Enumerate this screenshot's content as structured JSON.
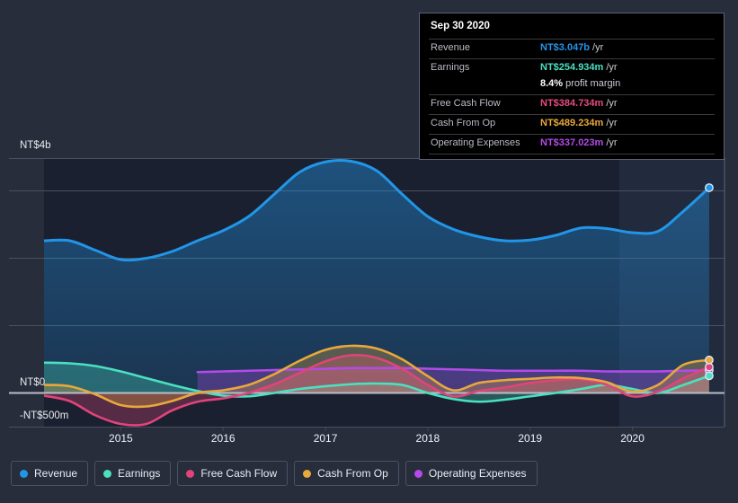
{
  "tooltip": {
    "date": "Sep 30 2020",
    "rows": [
      {
        "key": "Revenue",
        "value": "NT$3.047b",
        "unit": "/yr",
        "color": "#2196e8"
      },
      {
        "key": "Earnings",
        "value": "NT$254.934m",
        "unit": "/yr",
        "color": "#4ae0c0"
      },
      {
        "key": "",
        "value": "8.4%",
        "unit": "profit margin",
        "color": "#ffffff"
      },
      {
        "key": "Free Cash Flow",
        "value": "NT$384.734m",
        "unit": "/yr",
        "color": "#e84a7f"
      },
      {
        "key": "Cash From Op",
        "value": "NT$489.234m",
        "unit": "/yr",
        "color": "#e8a83c"
      },
      {
        "key": "Operating Expenses",
        "value": "NT$337.023m",
        "unit": "/yr",
        "color": "#b44ae8"
      }
    ]
  },
  "legend": {
    "items": [
      {
        "label": "Revenue",
        "color": "#2196e8",
        "icon": "legend-dot-icon"
      },
      {
        "label": "Earnings",
        "color": "#4ae0c0",
        "icon": "legend-dot-icon"
      },
      {
        "label": "Free Cash Flow",
        "color": "#e0447a",
        "icon": "legend-dot-icon"
      },
      {
        "label": "Cash From Op",
        "color": "#e8a83c",
        "icon": "legend-dot-icon"
      },
      {
        "label": "Operating Expenses",
        "color": "#b44ae8",
        "icon": "legend-dot-icon"
      }
    ]
  },
  "chart_data": {
    "type": "area",
    "title": "",
    "xlabel": "",
    "ylabel": "",
    "currency": "NT$",
    "grid": true,
    "legend_position": "bottom",
    "y_axis": {
      "labels": [
        "NT$4b",
        "NT$0",
        "-NT$500m"
      ],
      "top_label": "NT$4b",
      "zero_label": "NT$0",
      "bottom_label": "-NT$500m",
      "ylim": [
        -0.5,
        4.0
      ],
      "gridline_values": [
        4.0,
        3.5,
        2.5,
        1.5,
        0,
        -0.5
      ]
    },
    "x_axis": {
      "tick_labels": [
        "2015",
        "2016",
        "2017",
        "2018",
        "2019",
        "2020"
      ],
      "tick_values": [
        2015,
        2016,
        2017,
        2018,
        2019,
        2020
      ],
      "xlim": [
        2014.25,
        2020.9
      ],
      "highlight_from": 2019.75
    },
    "x": [
      2014.25,
      2014.5,
      2014.75,
      2015.0,
      2015.25,
      2015.5,
      2015.75,
      2016.0,
      2016.25,
      2016.5,
      2016.75,
      2017.0,
      2017.25,
      2017.5,
      2017.75,
      2018.0,
      2018.25,
      2018.5,
      2018.75,
      2019.0,
      2019.25,
      2019.5,
      2019.75,
      2020.0,
      2020.25,
      2020.5,
      2020.75
    ],
    "series": [
      {
        "name": "Revenue",
        "color": "#2196e8",
        "fill": true,
        "values": [
          2.26,
          2.26,
          2.12,
          1.98,
          2.0,
          2.1,
          2.26,
          2.41,
          2.62,
          2.95,
          3.28,
          3.43,
          3.44,
          3.3,
          2.95,
          2.62,
          2.43,
          2.32,
          2.26,
          2.27,
          2.34,
          2.45,
          2.44,
          2.38,
          2.4,
          2.7,
          3.047
        ],
        "end_value": "NT$3.047b"
      },
      {
        "name": "Earnings",
        "color": "#4ae0c0",
        "fill": true,
        "values": [
          0.45,
          0.44,
          0.4,
          0.32,
          0.22,
          0.12,
          0.03,
          -0.04,
          -0.05,
          0.0,
          0.06,
          0.1,
          0.13,
          0.14,
          0.12,
          0.0,
          -0.09,
          -0.13,
          -0.1,
          -0.05,
          0.0,
          0.06,
          0.12,
          0.06,
          0.0,
          0.12,
          0.255
        ],
        "end_value": "NT$254.934m"
      },
      {
        "name": "Free Cash Flow",
        "color": "#e0447a",
        "fill": true,
        "values": [
          -0.04,
          -0.12,
          -0.33,
          -0.46,
          -0.46,
          -0.26,
          -0.13,
          -0.08,
          0.0,
          0.13,
          0.3,
          0.47,
          0.56,
          0.52,
          0.36,
          0.12,
          -0.05,
          0.03,
          0.08,
          0.15,
          0.19,
          0.2,
          0.12,
          -0.05,
          0.02,
          0.22,
          0.385
        ],
        "end_value": "NT$384.734m"
      },
      {
        "name": "Cash From Op",
        "color": "#e8a83c",
        "fill": true,
        "values": [
          0.12,
          0.1,
          -0.02,
          -0.18,
          -0.2,
          -0.12,
          0.0,
          0.04,
          0.12,
          0.28,
          0.48,
          0.64,
          0.7,
          0.66,
          0.5,
          0.25,
          0.04,
          0.15,
          0.19,
          0.21,
          0.23,
          0.22,
          0.16,
          0.02,
          0.12,
          0.42,
          0.489
        ],
        "end_value": "NT$489.234m"
      },
      {
        "name": "Operating Expenses",
        "color": "#b44ae8",
        "fill": true,
        "values": [
          null,
          null,
          null,
          null,
          null,
          null,
          0.31,
          0.32,
          0.33,
          0.34,
          0.35,
          0.36,
          0.37,
          0.37,
          0.37,
          0.36,
          0.35,
          0.34,
          0.33,
          0.33,
          0.33,
          0.33,
          0.32,
          0.32,
          0.32,
          0.33,
          0.337
        ],
        "end_value": "NT$337.023m"
      }
    ]
  }
}
